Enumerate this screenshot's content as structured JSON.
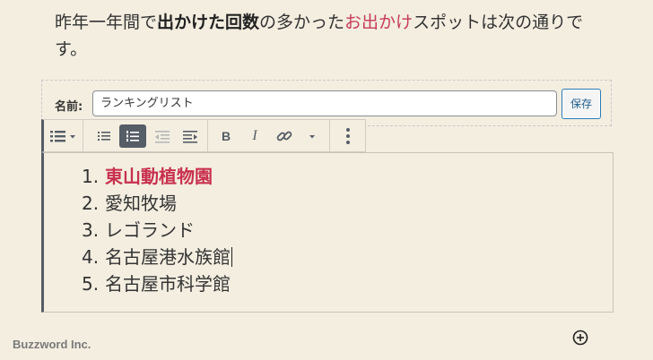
{
  "intro": {
    "seg1": "昨年一年間で",
    "seg2": "出かけた回数",
    "seg3": "の多かった",
    "seg4": "お出かけ",
    "seg5": "スポットは次の通りです。"
  },
  "name_bar": {
    "label": "名前:",
    "value": "ランキングリスト",
    "save_label": "保存"
  },
  "toolbar": {
    "bold_label": "B",
    "italic_label": "I"
  },
  "list": {
    "items": [
      {
        "num": "1.",
        "text": "東山動植物園"
      },
      {
        "num": "2.",
        "text": "愛知牧場"
      },
      {
        "num": "3.",
        "text": "レゴランド"
      },
      {
        "num": "4.",
        "text": "名古屋港水族館"
      },
      {
        "num": "5.",
        "text": "名古屋市科学館"
      }
    ]
  },
  "footer": {
    "brand": "Buzzword Inc."
  },
  "colors": {
    "background": "#f3eee0",
    "highlight": "#c73a5a",
    "accent": "#2a7bb5",
    "toolbar_icon": "#555d66"
  },
  "icons": [
    "list-style-icon",
    "dropdown-arrow-icon",
    "bulleted-list-icon",
    "numbered-list-icon",
    "outdent-icon",
    "indent-icon",
    "bold-icon",
    "italic-icon",
    "link-icon",
    "more-options-arrow-icon",
    "vertical-ellipsis-icon",
    "add-block-icon"
  ]
}
